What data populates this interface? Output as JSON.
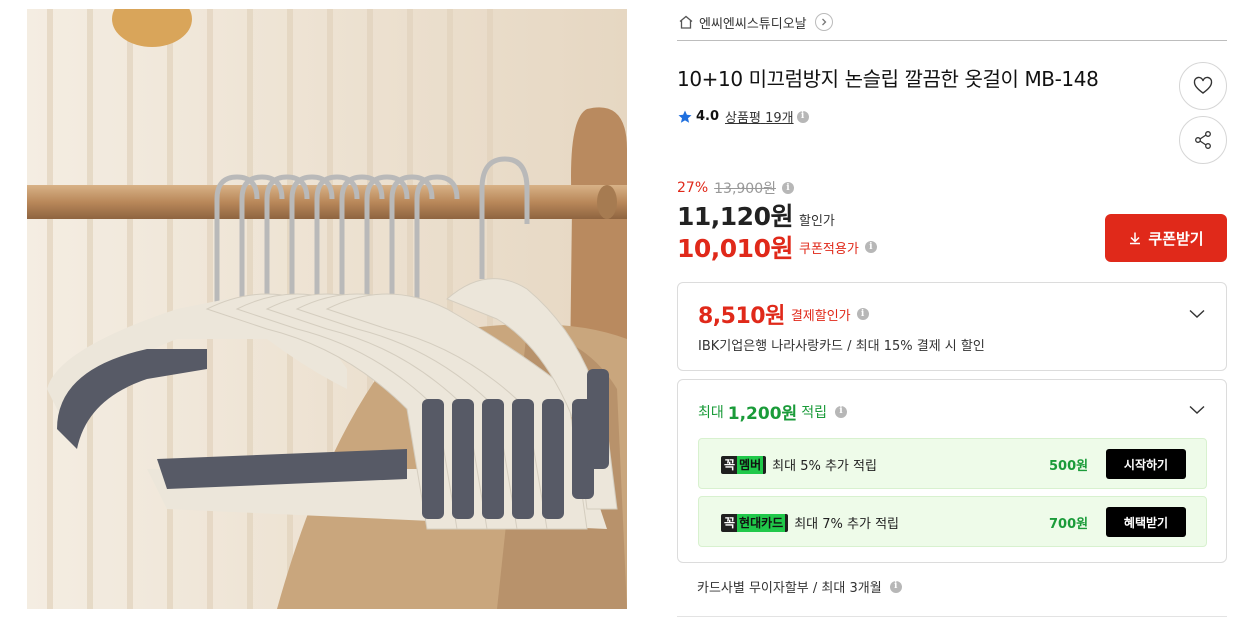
{
  "store": {
    "name": "엔씨엔씨스튜디오날",
    "home_icon": "home-icon",
    "chevron_icon": "chevron-right-icon"
  },
  "product": {
    "title": "10+10 미끄럼방지 논슬립 깔끔한 옷걸이 MB-148",
    "rating": "4.0",
    "reviews_label": "상품평",
    "reviews_count": "19개"
  },
  "price": {
    "discount_pct": "27%",
    "original": "13,900원",
    "sale": "11,120원",
    "sale_label": "할인가",
    "coupon_price": "10,010원",
    "coupon_label": "쿠폰적용가",
    "coupon_button": "쿠폰받기"
  },
  "card_discount": {
    "price": "8,510원",
    "label": "결제할인가",
    "desc": "IBK기업은행 나라사랑카드 / 최대 15% 결제 시 할인"
  },
  "points": {
    "prefix": "최대",
    "amount": "1,200원",
    "suffix": "적립",
    "rows": [
      {
        "badge_a": "꼭",
        "badge_b": "멤버",
        "text": "최대 5% 추가 적립",
        "amount": "500원",
        "button": "시작하기"
      },
      {
        "badge_a": "꼭",
        "badge_b": "현대카드",
        "text": "최대 7% 추가 적립",
        "amount": "700원",
        "button": "혜택받기"
      }
    ]
  },
  "installment": "카드사별 무이자할부 / 최대 3개월",
  "colors": {
    "accent_red": "#e0291a",
    "points_green": "#1a9b39",
    "reward_bg": "#eefbe9"
  }
}
